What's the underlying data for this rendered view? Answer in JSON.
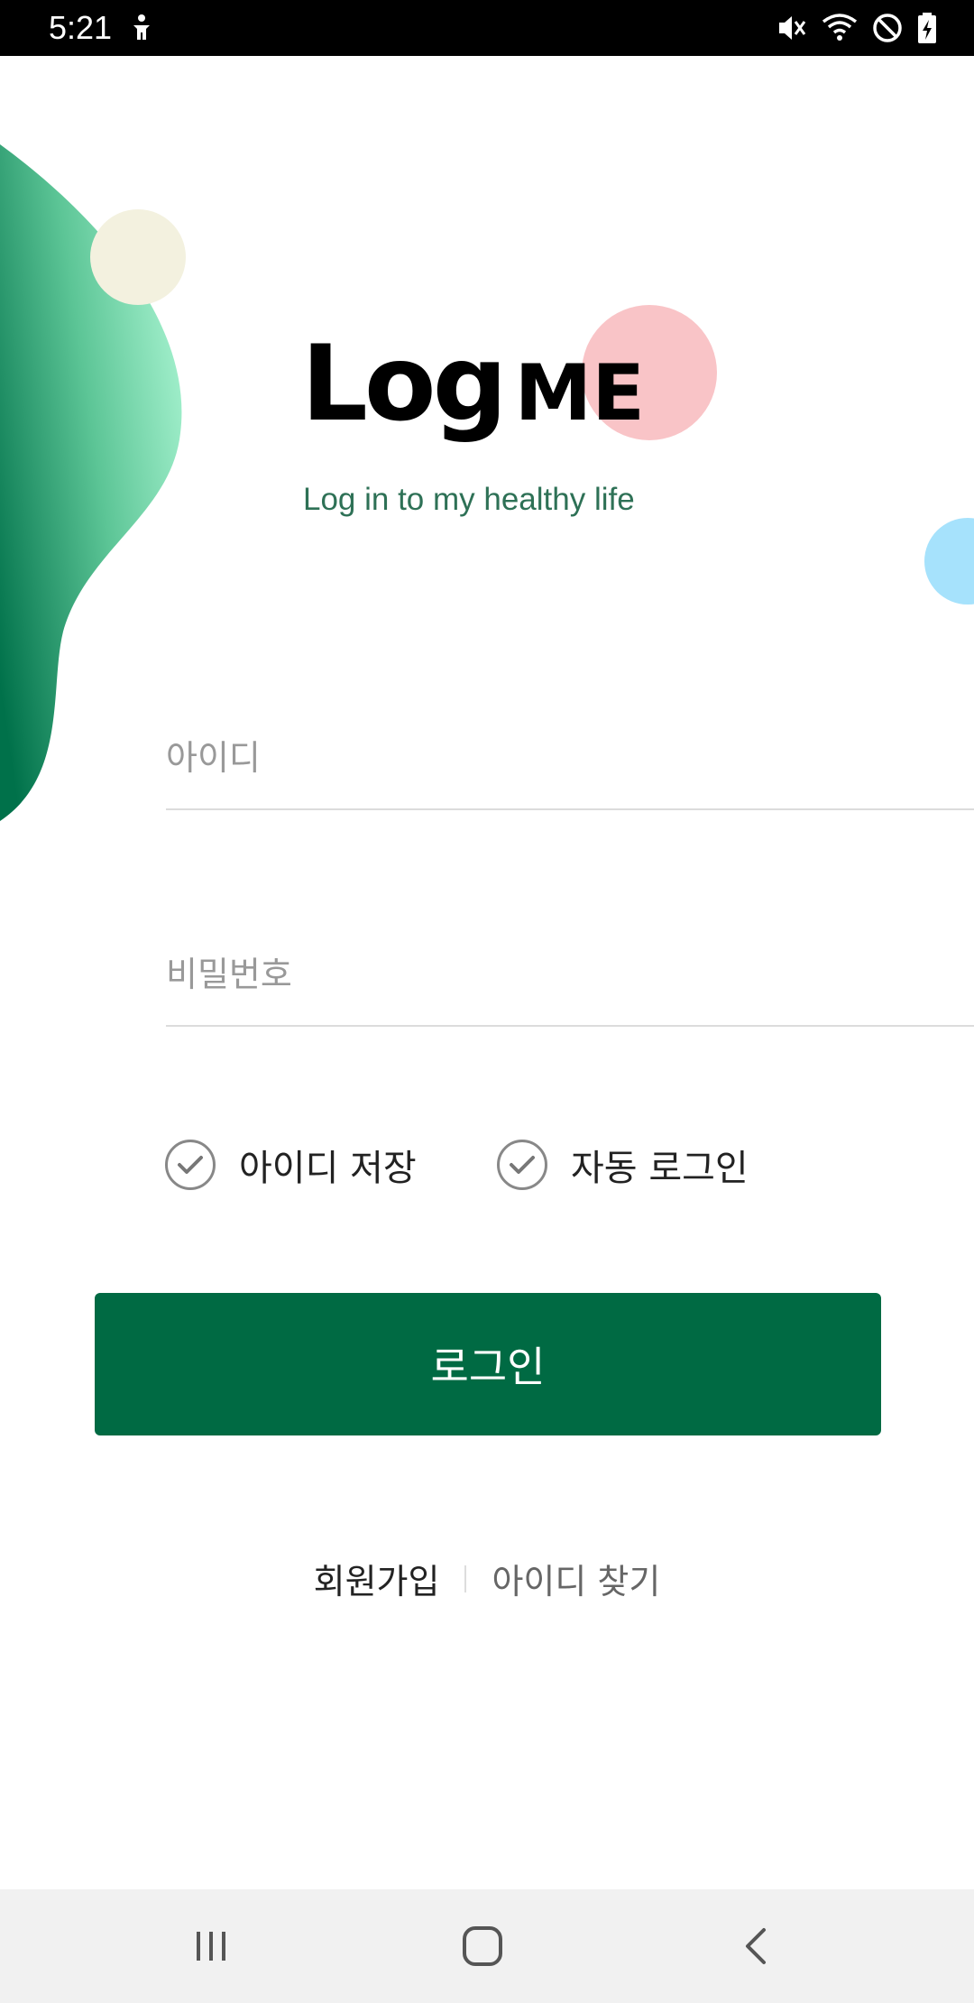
{
  "status_bar": {
    "time": "5:21",
    "left_icons": [
      "accessibility-icon"
    ],
    "right_icons": [
      "mute-icon",
      "wifi-icon",
      "do-not-disturb-icon",
      "battery-charging-icon"
    ]
  },
  "brand": {
    "logo_part1": "Log",
    "logo_part2": "ME",
    "tagline": "Log in to my healthy life",
    "accent_green": "#006a43",
    "tagline_color": "#2e7156"
  },
  "form": {
    "id_placeholder": "아이디",
    "password_placeholder": "비밀번호",
    "save_id_label": "아이디 저장",
    "auto_login_label": "자동 로그인",
    "login_button_label": "로그인"
  },
  "links": {
    "signup": "회원가입",
    "find_id": "아이디 찾기"
  },
  "nav_bar": {
    "icons": [
      "recent-apps-icon",
      "home-icon",
      "back-icon"
    ]
  }
}
